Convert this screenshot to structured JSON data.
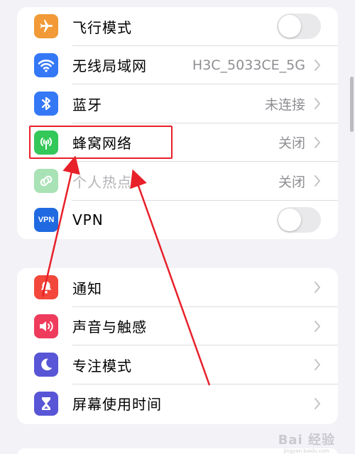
{
  "group1": {
    "rows": [
      {
        "label": "飞行模式",
        "icon": "airplane-icon",
        "icon_color": "#f19a37",
        "control": "toggle",
        "value": ""
      },
      {
        "label": "无线局域网",
        "icon": "wifi-icon",
        "icon_color": "#3478f6",
        "control": "chevron",
        "value": "H3C_5033CE_5G"
      },
      {
        "label": "蓝牙",
        "icon": "bluetooth-icon",
        "icon_color": "#3478f6",
        "control": "chevron",
        "value": "未连接"
      },
      {
        "label": "蜂窝网络",
        "icon": "cellular-icon",
        "icon_color": "#34c759",
        "control": "chevron",
        "value": "关闭"
      },
      {
        "label": "个人热点",
        "icon": "hotspot-icon",
        "icon_color": "#a8e2b5",
        "control": "chevron",
        "value": "关闭",
        "dimmed": true
      },
      {
        "label": "VPN",
        "icon": "vpn-icon",
        "icon_color": "#1f6ae0",
        "icon_text": "VPN",
        "control": "toggle",
        "value": ""
      }
    ],
    "airplane_toggle_on": false,
    "vpn_toggle_on": false
  },
  "group2": {
    "rows": [
      {
        "label": "通知",
        "icon": "notification-bell-icon",
        "icon_color": "#f2473a"
      },
      {
        "label": "声音与触感",
        "icon": "speaker-icon",
        "icon_color": "#ef3b5c"
      },
      {
        "label": "专注模式",
        "icon": "moon-icon",
        "icon_color": "#5856d6"
      },
      {
        "label": "屏幕使用时间",
        "icon": "hourglass-icon",
        "icon_color": "#5856d6"
      }
    ]
  },
  "annotation": {
    "highlight_color": "#e8202a",
    "highlighted_item": "蜂窝网络"
  },
  "watermark": {
    "text": "Bai 经验",
    "url": "jingyan.baidu.com"
  }
}
